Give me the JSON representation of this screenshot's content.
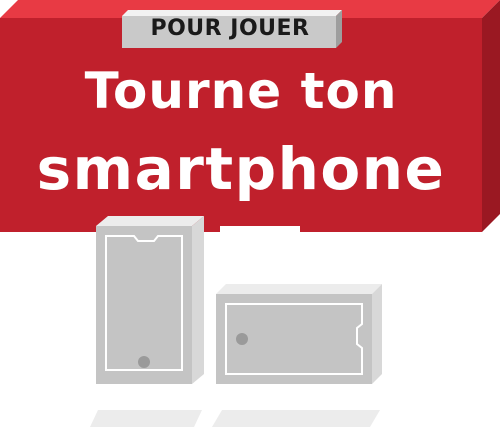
{
  "tag": {
    "label": "POUR JOUER"
  },
  "title": {
    "line1": "Tourne ton",
    "line2": "smartphone"
  },
  "phones": [
    {
      "orientation": "portrait"
    },
    {
      "orientation": "landscape"
    }
  ],
  "colors": {
    "banner_front": "#c0202c",
    "banner_top": "#e83a44",
    "banner_side": "#8f1620",
    "tag_front": "#c8c8c8",
    "tag_top": "#f0f0f0",
    "phone_body": "#c4c4c4",
    "phone_edge": "#e8e8e8",
    "shadow": "#ececec"
  }
}
